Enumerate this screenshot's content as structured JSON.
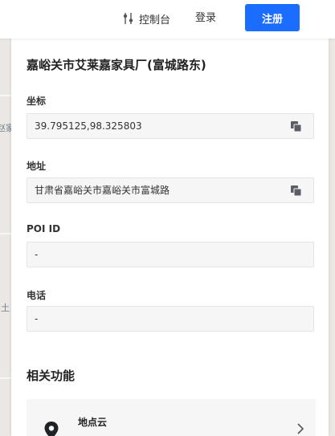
{
  "header": {
    "console_label": "控制台",
    "login_label": "登录",
    "register_label": "注册",
    "register_color": "#1a6dff"
  },
  "map": {
    "labels": [
      "赵家",
      "i土"
    ]
  },
  "place": {
    "title": "嘉峪关市艾莱嘉家具厂(富城路东)"
  },
  "fields": {
    "coordinates": {
      "label": "坐标",
      "value": "39.795125,98.325803"
    },
    "address": {
      "label": "地址",
      "value": "甘肃省嘉峪关市嘉峪关市富城路"
    },
    "poi_id": {
      "label": "POI ID",
      "value": "-"
    },
    "phone": {
      "label": "电话",
      "value": "-"
    }
  },
  "related": {
    "title": "相关功能",
    "items": [
      {
        "label": "地点云",
        "icon": "map-pin-icon"
      }
    ]
  }
}
